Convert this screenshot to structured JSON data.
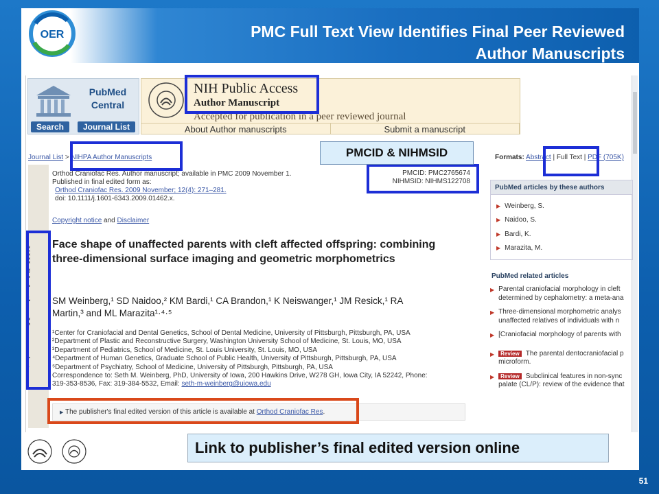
{
  "slide": {
    "title_line1": "PMC Full Text View Identifies Final Peer Reviewed",
    "title_line2": "Author Manuscripts",
    "logo_text": "OER",
    "slide_number": "51",
    "callout_pmcid": "PMCID & NIHMSID",
    "callout_publisher": "Link to publisher’s final edited version online"
  },
  "pmc": {
    "name_line1": "PubMed",
    "name_line2": "Central",
    "search_btn": "Search",
    "journal_list_btn": "Journal List"
  },
  "nih_header": {
    "title": "NIH Public Access",
    "subtitle": "Author Manuscript",
    "accepted": "Accepted for publication in a peer reviewed journal",
    "link_about": "About Author manuscripts",
    "link_submit": "Submit a manuscript"
  },
  "breadcrumb": {
    "journal_list": "Journal List",
    "sep": ">",
    "nihpa": "NIHPA Author Manuscripts"
  },
  "formats": {
    "label": "Formats:",
    "abstract": "Abstract",
    "sep": "|",
    "full_text": "Full Text",
    "pdf": "PDF (705K)"
  },
  "nihpa_vertical": "NIH-PA Author Manuscript",
  "meta": {
    "line1": "Orthod Craniofac Res. Author manuscript; available in PMC 2009 November 1.",
    "line2": "Published in final edited form as:",
    "line3": "Orthod Craniofac Res. 2009 November; 12(4): 271–281.",
    "line4": "doi: 10.1111/j.1601-6343.2009.01462.x."
  },
  "ids": {
    "pmcid": "PMCID: PMC2765674",
    "nihmsid": "NIHMSID: NIHMS122708"
  },
  "copyright": {
    "copyright_notice": "Copyright notice",
    "and": "and",
    "disclaimer": "Disclaimer"
  },
  "article": {
    "title": "Face shape of unaffected parents with cleft affected offspring: combining three-dimensional surface imaging and geometric morphometrics",
    "authors_line1": "SM Weinberg,¹ SD Naidoo,² KM Bardi,¹ CA Brandon,¹ K Neiswanger,¹ JM Resick,¹ RA",
    "authors_line2": "Martin,³ and ML Marazita¹·⁴·⁵",
    "affiliations": [
      "¹Center for Craniofacial and Dental Genetics, School of Dental Medicine, University of Pittsburgh, Pittsburgh, PA, USA",
      "²Department of Plastic and Reconstructive Surgery, Washington University School of Medicine, St. Louis, MO, USA",
      "³Department of Pediatrics, School of Medicine, St. Louis University, St. Louis, MO, USA",
      "⁴Department of Human Genetics, Graduate School of Public Health, University of Pittsburgh, Pittsburgh, PA, USA",
      "⁵Department of Psychiatry, School of Medicine, University of Pittsburgh, Pittsburgh, PA, USA"
    ],
    "correspondence_line1": "Correspondence to: Seth M. Weinberg, PhD, University of Iowa, 200 Hawkins Drive, W278 GH, Iowa City, IA 52242, Phone:",
    "correspondence_line2": "319-353-8536, Fax: 319-384-5532, Email:",
    "email": "seth-m-weinberg@uiowa.edu",
    "publisher_note": "The publisher's final edited version of this article is available at",
    "publisher_link": "Orthod Craniofac Res",
    "publisher_period": "."
  },
  "sidebar": {
    "authors_heading": "PubMed articles by these authors",
    "authors": [
      "Weinberg, S.",
      "Naidoo, S.",
      "Bardi, K.",
      "Marazita, M."
    ],
    "related_heading": "PubMed related articles",
    "related": [
      {
        "tag": "",
        "line1": "Parental craniofacial morphology in cleft",
        "line2": "determined by cephalometry: a meta-ana"
      },
      {
        "tag": "",
        "line1": "Three-dimensional morphometric analys",
        "line2": "unaffected relatives of individuals with n"
      },
      {
        "tag": "",
        "line1": "[Craniofacial morphology of parents with",
        "line2": ""
      },
      {
        "tag": "Review",
        "line1": "The parental dentocraniofacial p",
        "line2": "microform."
      },
      {
        "tag": "Review",
        "line1": "Subclinical features in non-sync",
        "line2": "palate (CL/P): review of the evidence that"
      }
    ]
  },
  "colors": {
    "slide_blue": "#0d5fae",
    "highlight_blue": "#1c2ed6",
    "highlight_red": "#d9481a",
    "callout_fill": "#dbeefb"
  }
}
